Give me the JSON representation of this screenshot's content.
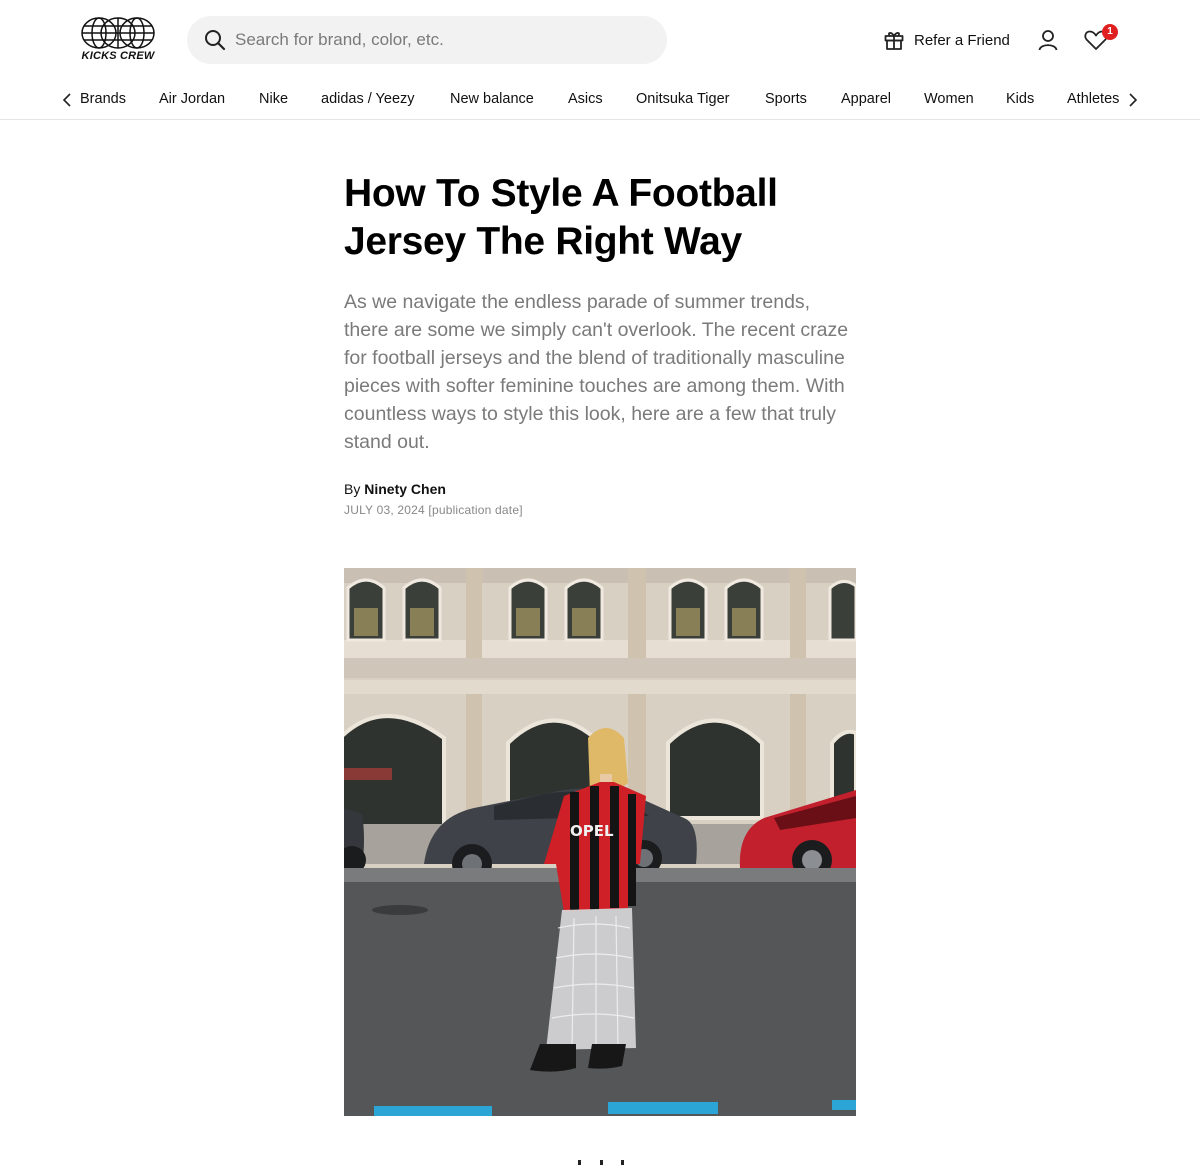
{
  "header": {
    "logo_text": "KICKS CREW",
    "search": {
      "placeholder": "Search for brand, color, etc.",
      "value": ""
    },
    "refer_label": "Refer a Friend",
    "wishlist_count": "1"
  },
  "nav": {
    "items": [
      "Brands",
      "Air Jordan",
      "Nike",
      "adidas / Yeezy",
      "New balance",
      "Asics",
      "Onitsuka Tiger",
      "Sports",
      "Apparel",
      "Women",
      "Kids",
      "Athletes"
    ]
  },
  "article": {
    "title": "How To Style A Football Jersey The Right Way",
    "lede": "As we navigate the endless parade of summer trends, there are some we simply can't overlook. The recent craze for football jerseys and the blend of traditionally masculine pieces with softer feminine touches are among them. With countless ways to style this look, here are a few that truly stand out.",
    "byline_prefix": "By",
    "author": "Ninety Chen",
    "date": "JULY 03, 2024 [publication date]",
    "photo_jersey_text": "OPEL"
  },
  "colors": {
    "accent_badge": "#e02020",
    "lede_text": "#7a7a7a",
    "search_bg": "#f2f2f2"
  }
}
